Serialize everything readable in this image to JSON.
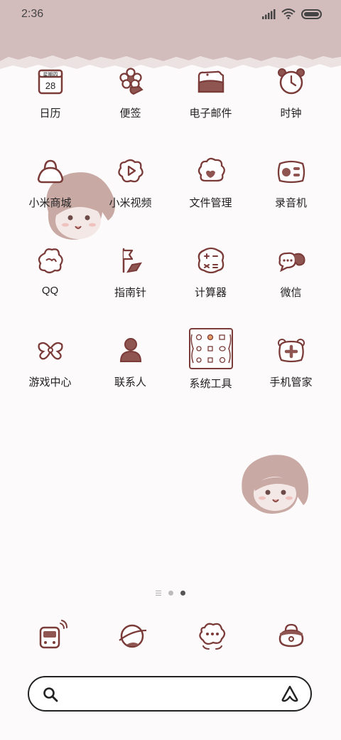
{
  "status_bar": {
    "time": "2:36"
  },
  "apps": [
    {
      "label": "日历",
      "icon": "calendar-icon",
      "calendar_weekday": "星期四",
      "calendar_day": "28"
    },
    {
      "label": "便签",
      "icon": "flower-note-icon"
    },
    {
      "label": "电子邮件",
      "icon": "mail-icon"
    },
    {
      "label": "时钟",
      "icon": "clock-icon"
    },
    {
      "label": "小米商城",
      "icon": "shop-bag-icon"
    },
    {
      "label": "小米视频",
      "icon": "video-play-icon"
    },
    {
      "label": "文件管理",
      "icon": "folder-cloud-icon"
    },
    {
      "label": "录音机",
      "icon": "radio-recorder-icon"
    },
    {
      "label": "QQ",
      "icon": "qq-icon"
    },
    {
      "label": "指南针",
      "icon": "compass-flag-icon"
    },
    {
      "label": "计算器",
      "icon": "calculator-icon"
    },
    {
      "label": "微信",
      "icon": "wechat-icon"
    },
    {
      "label": "游戏中心",
      "icon": "game-bow-icon"
    },
    {
      "label": "联系人",
      "icon": "contact-person-icon"
    },
    {
      "label": "系统工具",
      "icon": "tools-folder-icon"
    },
    {
      "label": "手机管家",
      "icon": "security-plus-icon"
    }
  ],
  "page_indicator": {
    "pages": 3,
    "active": 3
  },
  "dock": [
    {
      "icon": "phone-call-icon"
    },
    {
      "icon": "browser-planet-icon"
    },
    {
      "icon": "message-bubble-icon"
    },
    {
      "icon": "camera-bag-icon"
    }
  ],
  "search": {
    "value": "",
    "placeholder": ""
  },
  "colors": {
    "accent": "#7a3b39",
    "band": "#d3bcbc",
    "fill": "#8e5551"
  }
}
